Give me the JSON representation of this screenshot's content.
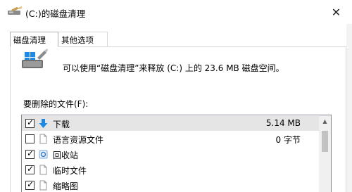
{
  "window": {
    "title": "(C:)的磁盘清理",
    "close_glyph": "✕"
  },
  "tabs": [
    {
      "label": "磁盘清理",
      "active": true
    },
    {
      "label": "其他选项",
      "active": false
    }
  ],
  "summary_text": "可以使用“磁盘清理”来释放  (C:) 上的 23.6 MB 磁盘空间。",
  "files_label": "要删除的文件(F):",
  "files": [
    {
      "name": "下载",
      "size": "5.14 MB",
      "checked": true,
      "icon": "download-arrow-icon",
      "selected": true
    },
    {
      "name": "语言资源文件",
      "size": "0 字节",
      "checked": false,
      "icon": "blank-file-icon",
      "selected": false
    },
    {
      "name": "回收站",
      "size": "",
      "checked": true,
      "icon": "recycle-bin-icon",
      "selected": false
    },
    {
      "name": "临时文件",
      "size": "",
      "checked": true,
      "icon": "blank-file-icon",
      "selected": false
    },
    {
      "name": "缩略图",
      "size": "",
      "checked": true,
      "icon": "blank-file-icon",
      "selected": false
    }
  ],
  "check_glyph": "✓",
  "scroll_up_glyph": "▲",
  "colors": {
    "accent_blue": "#1e88e5",
    "border": "#d9d9d9"
  }
}
